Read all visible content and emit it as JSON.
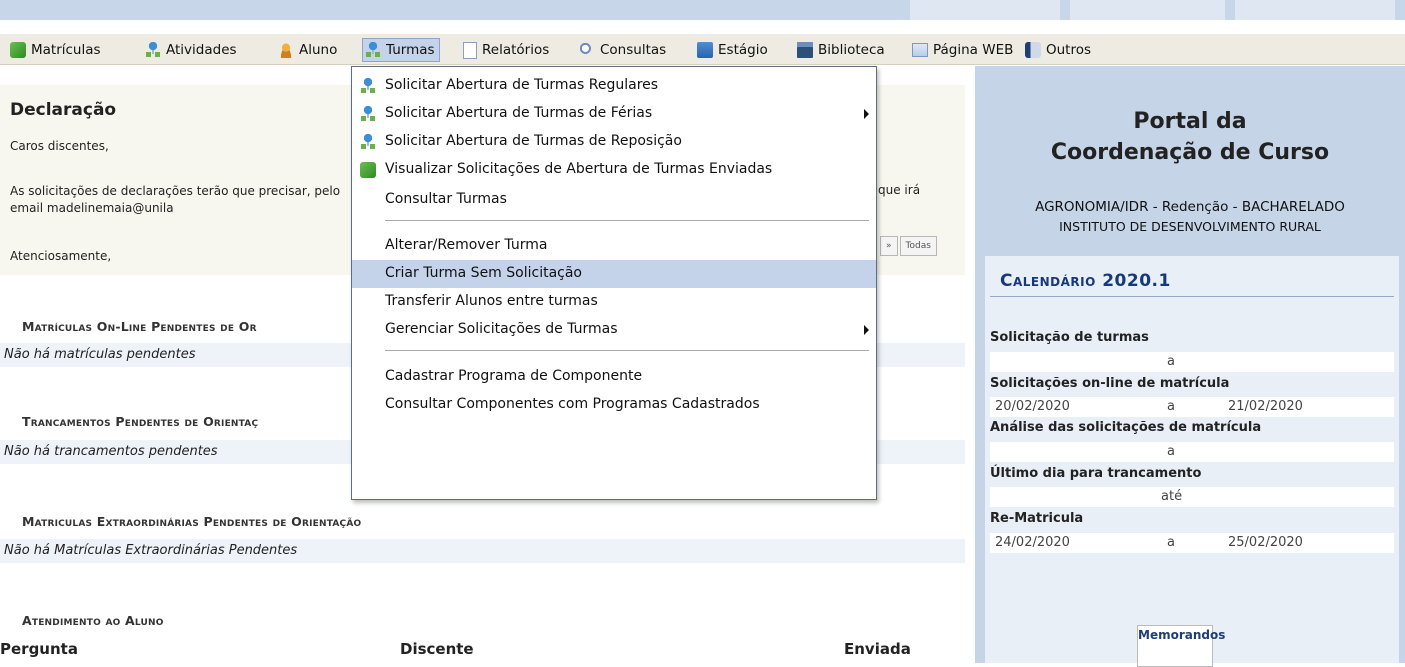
{
  "menu": {
    "items": [
      {
        "label": "Matrículas",
        "icon": "matriculas-icon"
      },
      {
        "label": "Atividades",
        "icon": "atividades-icon"
      },
      {
        "label": "Aluno",
        "icon": "aluno-icon"
      },
      {
        "label": "Turmas",
        "icon": "turmas-icon"
      },
      {
        "label": "Relatórios",
        "icon": "relatorios-icon"
      },
      {
        "label": "Consultas",
        "icon": "consultas-icon"
      },
      {
        "label": "Estágio",
        "icon": "estagio-icon"
      },
      {
        "label": "Biblioteca",
        "icon": "biblioteca-icon"
      },
      {
        "label": "Página WEB",
        "icon": "pagina-web-icon"
      },
      {
        "label": "Outros",
        "icon": "outros-icon"
      }
    ]
  },
  "dropdown": {
    "items": [
      {
        "label": "Solicitar Abertura de Turmas Regulares"
      },
      {
        "label": "Solicitar Abertura de Turmas de Férias"
      },
      {
        "label": "Solicitar Abertura de Turmas de Reposição"
      },
      {
        "label": "Visualizar Solicitações de Abertura de Turmas Enviadas"
      },
      {
        "label": "Consultar Turmas"
      },
      {
        "label": "Alterar/Remover Turma"
      },
      {
        "label": "Criar Turma Sem Solicitação"
      },
      {
        "label": "Transferir Alunos entre turmas"
      },
      {
        "label": "Gerenciar Solicitações de Turmas"
      },
      {
        "label": "Cadastrar Programa de Componente"
      },
      {
        "label": "Consultar Componentes com Programas Cadastrados"
      }
    ]
  },
  "declaracao": {
    "title": "Declaração",
    "line1": "Caros discentes,",
    "line2": "As solicitações de declarações terão que precisar, pelo email madelinemaia@unila",
    "line2_right": "que irá",
    "line3": "Atenciosamente,",
    "pager_next": "»",
    "pager_all": "Todas"
  },
  "sections": {
    "matriculas_title": "Matrículas On-Line Pendentes de Or",
    "matriculas_empty": "Não há matrículas pendentes",
    "trancamentos_title": "Trancamentos Pendentes de Orientaç",
    "trancamentos_empty": "Não há trancamentos pendentes",
    "extra_title": "Matriculas Extraordinárias Pendentes de Orientação",
    "extra_empty": "Não há Matrículas Extraordinárias Pendentes",
    "atendimento_title": "Atendimento ao Aluno",
    "col_pergunta": "Pergunta",
    "col_discente": "Discente",
    "col_enviada": "Enviada"
  },
  "portal": {
    "title_line1": "Portal da",
    "title_line2": "Coordenação de Curso",
    "course": "AGRONOMIA/IDR - Redenção - BACHARELADO",
    "institute": "INSTITUTO DE DESENVOLVIMENTO RURAL"
  },
  "calendar": {
    "title": "Calendário 2020.1",
    "entries": [
      {
        "label": "Solicitação de turmas",
        "start": "",
        "sep": "a",
        "end": ""
      },
      {
        "label": "Solicitações on-line de matrícula",
        "start": "20/02/2020",
        "sep": "a",
        "end": "21/02/2020"
      },
      {
        "label": "Análise das solicitações de matrícula",
        "start": "",
        "sep": "a",
        "end": ""
      },
      {
        "label": "Último dia para trancamento",
        "start": "",
        "sep": "até",
        "end": ""
      },
      {
        "label": "Re-Matricula",
        "start": "24/02/2020",
        "sep": "a",
        "end": "25/02/2020"
      }
    ]
  },
  "memo": {
    "label": "Memorandos"
  }
}
